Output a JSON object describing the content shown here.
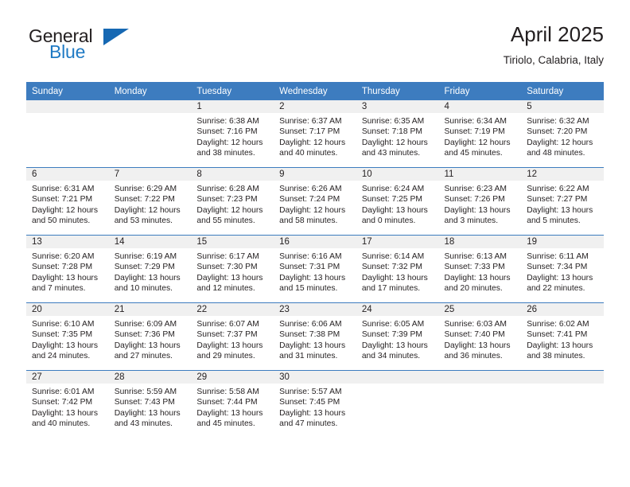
{
  "brand": {
    "name_top": "General",
    "name_bottom": "Blue",
    "accent_color": "#1668b3"
  },
  "header": {
    "title": "April 2025",
    "subtitle": "Tiriolo, Calabria, Italy"
  },
  "theme": {
    "header_row_color": "#3d7cbf",
    "daynum_band_color": "#f0f0f0",
    "text_color": "#231f20"
  },
  "weekday_headers": [
    "Sunday",
    "Monday",
    "Tuesday",
    "Wednesday",
    "Thursday",
    "Friday",
    "Saturday"
  ],
  "labels": {
    "sunrise_prefix": "Sunrise:",
    "sunset_prefix": "Sunset:",
    "daylight_prefix": "Daylight:"
  },
  "weeks": [
    [
      {
        "day": "",
        "blank": true
      },
      {
        "day": "",
        "blank": true
      },
      {
        "day": "1",
        "sunrise": "Sunrise: 6:38 AM",
        "sunset": "Sunset: 7:16 PM",
        "daylight_1": "Daylight: 12 hours",
        "daylight_2": "and 38 minutes."
      },
      {
        "day": "2",
        "sunrise": "Sunrise: 6:37 AM",
        "sunset": "Sunset: 7:17 PM",
        "daylight_1": "Daylight: 12 hours",
        "daylight_2": "and 40 minutes."
      },
      {
        "day": "3",
        "sunrise": "Sunrise: 6:35 AM",
        "sunset": "Sunset: 7:18 PM",
        "daylight_1": "Daylight: 12 hours",
        "daylight_2": "and 43 minutes."
      },
      {
        "day": "4",
        "sunrise": "Sunrise: 6:34 AM",
        "sunset": "Sunset: 7:19 PM",
        "daylight_1": "Daylight: 12 hours",
        "daylight_2": "and 45 minutes."
      },
      {
        "day": "5",
        "sunrise": "Sunrise: 6:32 AM",
        "sunset": "Sunset: 7:20 PM",
        "daylight_1": "Daylight: 12 hours",
        "daylight_2": "and 48 minutes."
      }
    ],
    [
      {
        "day": "6",
        "sunrise": "Sunrise: 6:31 AM",
        "sunset": "Sunset: 7:21 PM",
        "daylight_1": "Daylight: 12 hours",
        "daylight_2": "and 50 minutes."
      },
      {
        "day": "7",
        "sunrise": "Sunrise: 6:29 AM",
        "sunset": "Sunset: 7:22 PM",
        "daylight_1": "Daylight: 12 hours",
        "daylight_2": "and 53 minutes."
      },
      {
        "day": "8",
        "sunrise": "Sunrise: 6:28 AM",
        "sunset": "Sunset: 7:23 PM",
        "daylight_1": "Daylight: 12 hours",
        "daylight_2": "and 55 minutes."
      },
      {
        "day": "9",
        "sunrise": "Sunrise: 6:26 AM",
        "sunset": "Sunset: 7:24 PM",
        "daylight_1": "Daylight: 12 hours",
        "daylight_2": "and 58 minutes."
      },
      {
        "day": "10",
        "sunrise": "Sunrise: 6:24 AM",
        "sunset": "Sunset: 7:25 PM",
        "daylight_1": "Daylight: 13 hours",
        "daylight_2": "and 0 minutes."
      },
      {
        "day": "11",
        "sunrise": "Sunrise: 6:23 AM",
        "sunset": "Sunset: 7:26 PM",
        "daylight_1": "Daylight: 13 hours",
        "daylight_2": "and 3 minutes."
      },
      {
        "day": "12",
        "sunrise": "Sunrise: 6:22 AM",
        "sunset": "Sunset: 7:27 PM",
        "daylight_1": "Daylight: 13 hours",
        "daylight_2": "and 5 minutes."
      }
    ],
    [
      {
        "day": "13",
        "sunrise": "Sunrise: 6:20 AM",
        "sunset": "Sunset: 7:28 PM",
        "daylight_1": "Daylight: 13 hours",
        "daylight_2": "and 7 minutes."
      },
      {
        "day": "14",
        "sunrise": "Sunrise: 6:19 AM",
        "sunset": "Sunset: 7:29 PM",
        "daylight_1": "Daylight: 13 hours",
        "daylight_2": "and 10 minutes."
      },
      {
        "day": "15",
        "sunrise": "Sunrise: 6:17 AM",
        "sunset": "Sunset: 7:30 PM",
        "daylight_1": "Daylight: 13 hours",
        "daylight_2": "and 12 minutes."
      },
      {
        "day": "16",
        "sunrise": "Sunrise: 6:16 AM",
        "sunset": "Sunset: 7:31 PM",
        "daylight_1": "Daylight: 13 hours",
        "daylight_2": "and 15 minutes."
      },
      {
        "day": "17",
        "sunrise": "Sunrise: 6:14 AM",
        "sunset": "Sunset: 7:32 PM",
        "daylight_1": "Daylight: 13 hours",
        "daylight_2": "and 17 minutes."
      },
      {
        "day": "18",
        "sunrise": "Sunrise: 6:13 AM",
        "sunset": "Sunset: 7:33 PM",
        "daylight_1": "Daylight: 13 hours",
        "daylight_2": "and 20 minutes."
      },
      {
        "day": "19",
        "sunrise": "Sunrise: 6:11 AM",
        "sunset": "Sunset: 7:34 PM",
        "daylight_1": "Daylight: 13 hours",
        "daylight_2": "and 22 minutes."
      }
    ],
    [
      {
        "day": "20",
        "sunrise": "Sunrise: 6:10 AM",
        "sunset": "Sunset: 7:35 PM",
        "daylight_1": "Daylight: 13 hours",
        "daylight_2": "and 24 minutes."
      },
      {
        "day": "21",
        "sunrise": "Sunrise: 6:09 AM",
        "sunset": "Sunset: 7:36 PM",
        "daylight_1": "Daylight: 13 hours",
        "daylight_2": "and 27 minutes."
      },
      {
        "day": "22",
        "sunrise": "Sunrise: 6:07 AM",
        "sunset": "Sunset: 7:37 PM",
        "daylight_1": "Daylight: 13 hours",
        "daylight_2": "and 29 minutes."
      },
      {
        "day": "23",
        "sunrise": "Sunrise: 6:06 AM",
        "sunset": "Sunset: 7:38 PM",
        "daylight_1": "Daylight: 13 hours",
        "daylight_2": "and 31 minutes."
      },
      {
        "day": "24",
        "sunrise": "Sunrise: 6:05 AM",
        "sunset": "Sunset: 7:39 PM",
        "daylight_1": "Daylight: 13 hours",
        "daylight_2": "and 34 minutes."
      },
      {
        "day": "25",
        "sunrise": "Sunrise: 6:03 AM",
        "sunset": "Sunset: 7:40 PM",
        "daylight_1": "Daylight: 13 hours",
        "daylight_2": "and 36 minutes."
      },
      {
        "day": "26",
        "sunrise": "Sunrise: 6:02 AM",
        "sunset": "Sunset: 7:41 PM",
        "daylight_1": "Daylight: 13 hours",
        "daylight_2": "and 38 minutes."
      }
    ],
    [
      {
        "day": "27",
        "sunrise": "Sunrise: 6:01 AM",
        "sunset": "Sunset: 7:42 PM",
        "daylight_1": "Daylight: 13 hours",
        "daylight_2": "and 40 minutes."
      },
      {
        "day": "28",
        "sunrise": "Sunrise: 5:59 AM",
        "sunset": "Sunset: 7:43 PM",
        "daylight_1": "Daylight: 13 hours",
        "daylight_2": "and 43 minutes."
      },
      {
        "day": "29",
        "sunrise": "Sunrise: 5:58 AM",
        "sunset": "Sunset: 7:44 PM",
        "daylight_1": "Daylight: 13 hours",
        "daylight_2": "and 45 minutes."
      },
      {
        "day": "30",
        "sunrise": "Sunrise: 5:57 AM",
        "sunset": "Sunset: 7:45 PM",
        "daylight_1": "Daylight: 13 hours",
        "daylight_2": "and 47 minutes."
      },
      {
        "day": "",
        "blank": true
      },
      {
        "day": "",
        "blank": true
      },
      {
        "day": "",
        "blank": true
      }
    ]
  ]
}
